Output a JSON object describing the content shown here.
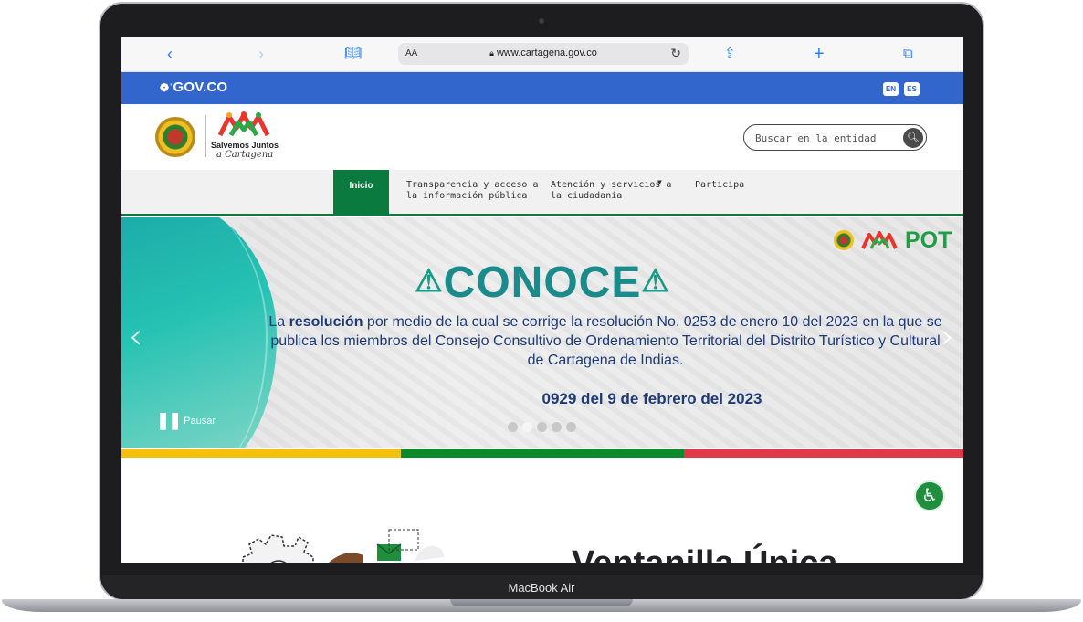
{
  "device": {
    "model_label": "MacBook Air"
  },
  "browser": {
    "reader_label": "AA",
    "url": "www.cartagena.gov.co"
  },
  "govbar": {
    "logo_text": "GOV.CO",
    "languages": [
      "EN",
      "ES"
    ],
    "color": "#3366cc"
  },
  "header": {
    "brand_title": "Salvemos Juntos",
    "brand_subtitle": "a Cartagena",
    "search_placeholder": "Buscar en la entidad"
  },
  "menu": {
    "items": [
      {
        "label_1": "Inicio",
        "label_2": ""
      },
      {
        "label_1": "Transparencia y acceso a",
        "label_2": "la información pública"
      },
      {
        "label_1": "Atención y servicios a",
        "label_2": "la ciudadanía"
      },
      {
        "label_1": "Participa",
        "label_2": ""
      }
    ],
    "accent": "#0b7a3e"
  },
  "banner": {
    "badge": "POT",
    "headline": "CONOCE",
    "text_prefix": "La ",
    "text_bold": "resolución",
    "text_rest": " por medio de la cual se corrige la resolución No. 0253 de enero 10 del 2023 en la que se publica los miembros del Consejo Consultivo de Ordenamiento Territorial del Distrito Turístico y Cultural de Cartagena de Indias.",
    "date_line": "0929 del 9 de febrero del 2023",
    "pause_label": "Pausar",
    "slides": 5,
    "active_slide": 2
  },
  "stripe_colors": [
    "#f4c20d",
    "#0b8a2c",
    "#e03a4a"
  ],
  "content_peek": {
    "title_fragment": "Ventanilla Única"
  }
}
